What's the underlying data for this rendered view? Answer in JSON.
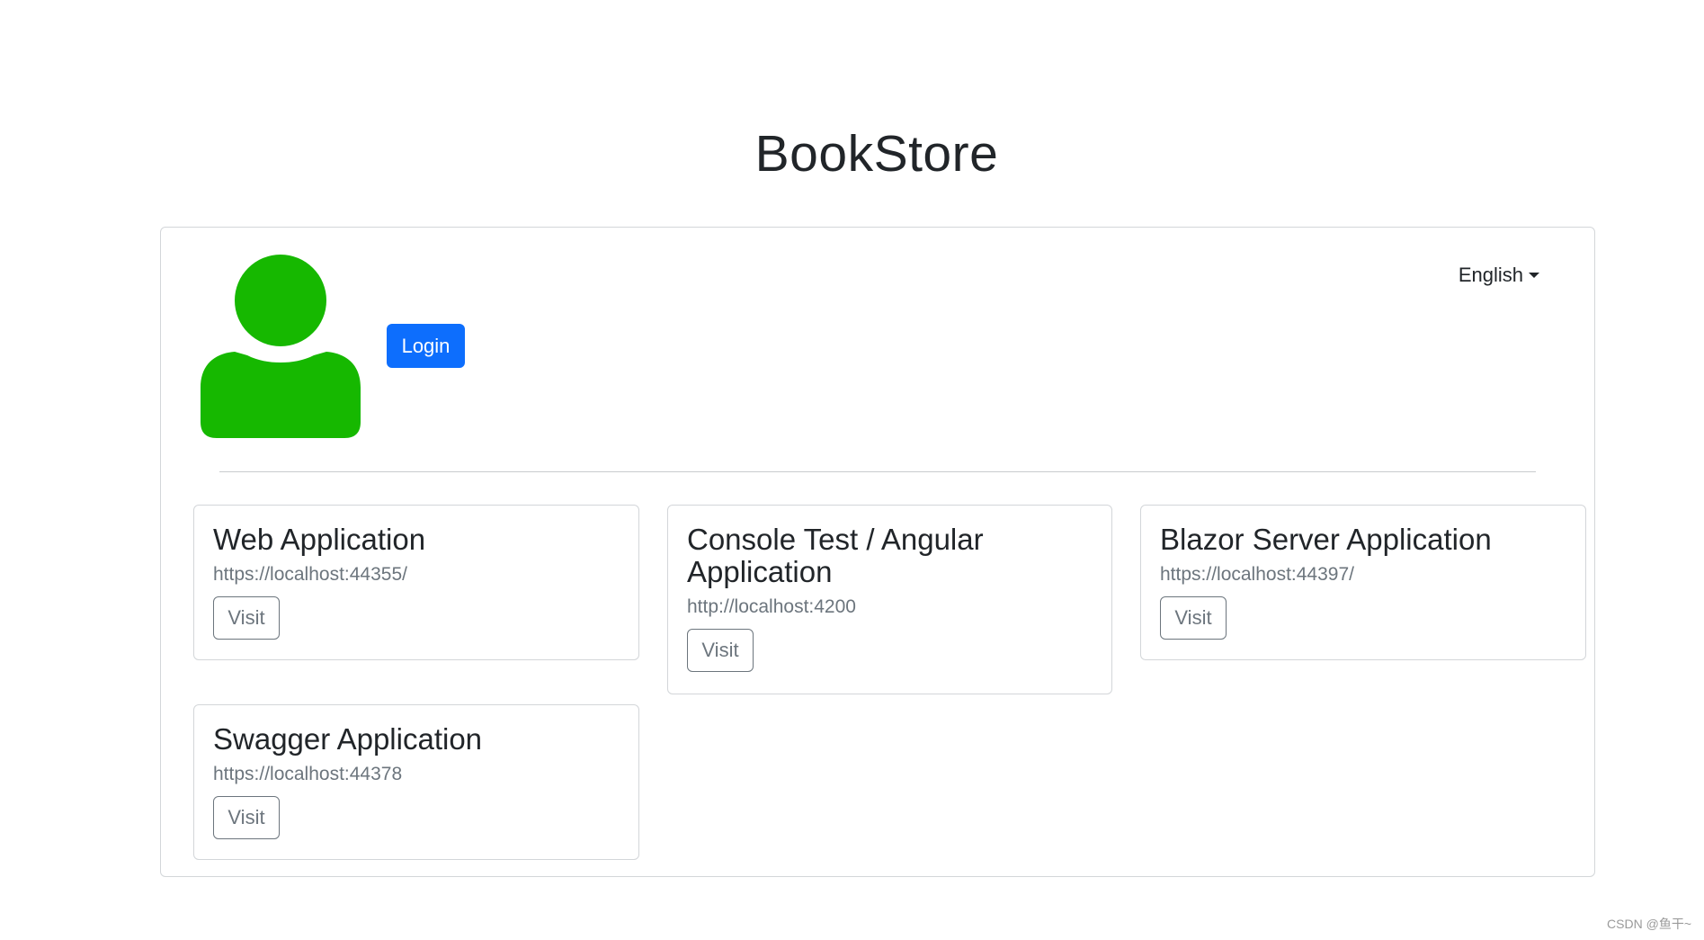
{
  "header": {
    "title": "BookStore"
  },
  "auth": {
    "login_label": "Login"
  },
  "language": {
    "selected": "English"
  },
  "apps": [
    {
      "title": "Web Application",
      "url": "https://localhost:44355/",
      "button": "Visit"
    },
    {
      "title": "Console Test / Angular Application",
      "url": "http://localhost:4200",
      "button": "Visit"
    },
    {
      "title": "Blazor Server Application",
      "url": "https://localhost:44397/",
      "button": "Visit"
    },
    {
      "title": "Swagger Application",
      "url": "https://localhost:44378",
      "button": "Visit"
    }
  ],
  "colors": {
    "avatar": "#16b800",
    "primary": "#0d6efd"
  },
  "watermark": "CSDN @鱼干~"
}
